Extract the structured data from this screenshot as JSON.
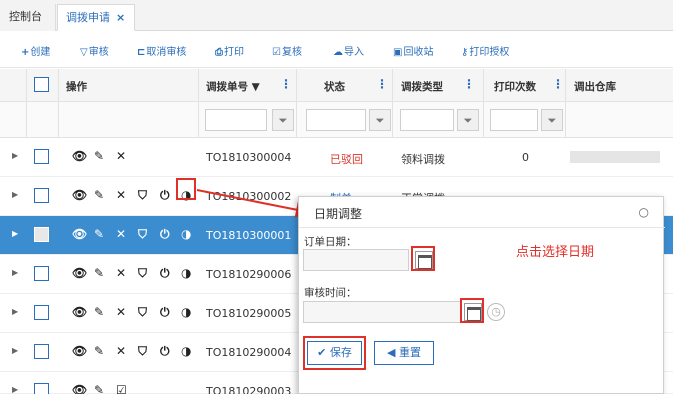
{
  "tabs": [
    {
      "label": "控制台"
    },
    {
      "label": "调拨申请",
      "close": "×"
    }
  ],
  "toolbar": {
    "create": {
      "icon": "+",
      "label": "创建"
    },
    "review": {
      "icon": "▽",
      "label": "审核"
    },
    "cancel_review": {
      "icon": "⊏",
      "label": "取消审核"
    },
    "print": {
      "icon": "⎙",
      "label": "打印"
    },
    "recheck": {
      "icon": "☑",
      "label": "复核"
    },
    "import": {
      "icon": "☁",
      "label": "导入"
    },
    "recycle": {
      "icon": "▣",
      "label": "回收站"
    },
    "print_auth": {
      "icon": "⚷",
      "label": "打印授权"
    }
  },
  "grid": {
    "headers": {
      "action": "操作",
      "code": "调拨单号 ▼",
      "status": "状态",
      "type": "调拨类型",
      "print_count": "打印次数",
      "warehouse": "调出仓库"
    },
    "col_menu": "⋮",
    "filter_icon": "⏷",
    "rows": [
      {
        "code": "TO1810300004",
        "status": "已驳回",
        "status_color": "#d9342b",
        "type": "领料调拨",
        "count": "0"
      },
      {
        "code": "TO1810300002",
        "status": "制单",
        "status_color": "#2a6ebb",
        "type": "正常调拨",
        "count": ""
      },
      {
        "code": "TO1810300001",
        "status": "",
        "type": "",
        "count": ""
      },
      {
        "code": "TO1810290006",
        "status": "",
        "type": "",
        "count": ""
      },
      {
        "code": "TO1810290005",
        "status": "",
        "type": "",
        "count": ""
      },
      {
        "code": "TO1810290004",
        "status": "",
        "type": "",
        "count": ""
      },
      {
        "code": "TO1810290003",
        "status": "",
        "type": "",
        "count": ""
      }
    ]
  },
  "dialog": {
    "title": "日期调整",
    "close": "○",
    "order_date_label": "订单日期：",
    "audit_time_label": "审核时间：",
    "save": "✔ 保存",
    "reset": "◀ 重置"
  },
  "annotation": "点击选择日期",
  "colors": {
    "accent": "#2a6ebb",
    "selected_row": "#3c8dcf",
    "highlight": "#e0302a"
  }
}
